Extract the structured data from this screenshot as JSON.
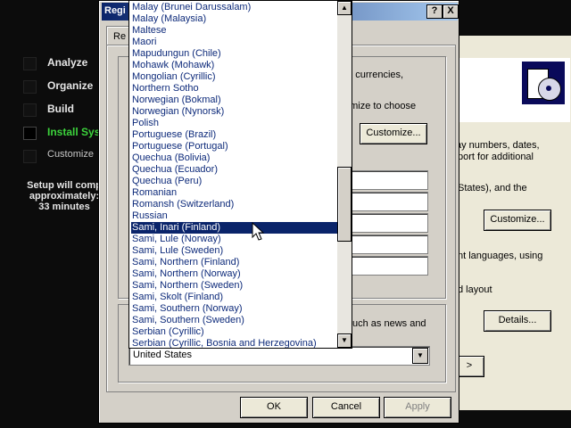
{
  "setup": {
    "steps": [
      {
        "label": "Analyze",
        "state": "done"
      },
      {
        "label": "Organize",
        "state": "done"
      },
      {
        "label": "Build",
        "state": "done"
      },
      {
        "label": "Install Sys",
        "state": "active"
      },
      {
        "label": "Customize",
        "state": "pending"
      }
    ],
    "note_lines": [
      "Setup will comp",
      "approximately:",
      "33 minutes"
    ]
  },
  "back_dialog": {
    "texts": [
      "rs, currencies,",
      "omize to choose",
      "ay numbers, dates,",
      "port for additional",
      "States), and the",
      "nt languages, using",
      "d layout",
      "uch as news and"
    ],
    "buttons": {
      "customize_top": "Customize...",
      "customize": "Customize...",
      "details": "Details..."
    }
  },
  "dialog": {
    "title": "Regi",
    "help_btn": "?",
    "close_btn": "X",
    "tab_label": "Re",
    "locale_combo_value": "United States",
    "buttons": {
      "ok": "OK",
      "cancel": "Cancel",
      "apply": "Apply"
    }
  },
  "dropdown": {
    "selected_index": 19,
    "items": [
      "Malay (Brunei Darussalam)",
      "Malay (Malaysia)",
      "Maltese",
      "Maori",
      "Mapudungun (Chile)",
      "Mohawk (Mohawk)",
      "Mongolian (Cyrillic)",
      "Northern Sotho",
      "Norwegian (Bokmal)",
      "Norwegian (Nynorsk)",
      "Polish",
      "Portuguese (Brazil)",
      "Portuguese (Portugal)",
      "Quechua (Bolivia)",
      "Quechua (Ecuador)",
      "Quechua (Peru)",
      "Romanian",
      "Romansh (Switzerland)",
      "Russian",
      "Sami, Inari (Finland)",
      "Sami, Lule (Norway)",
      "Sami, Lule (Sweden)",
      "Sami, Northern (Finland)",
      "Sami, Northern (Norway)",
      "Sami, Northern (Sweden)",
      "Sami, Skolt (Finland)",
      "Sami, Southern (Norway)",
      "Sami, Southern (Sweden)",
      "Serbian (Cyrillic)",
      "Serbian (Cyrillic, Bosnia and Herzegovina)"
    ]
  },
  "colors": {
    "title_bar": "#0a246a",
    "selection": "#0a246a",
    "active_step": "#3cd33c",
    "list_text": "#0d2a7a"
  },
  "icons": [
    "up-arrow-icon",
    "down-arrow-icon",
    "mouse-pointer-icon",
    "setup-package-icon"
  ]
}
